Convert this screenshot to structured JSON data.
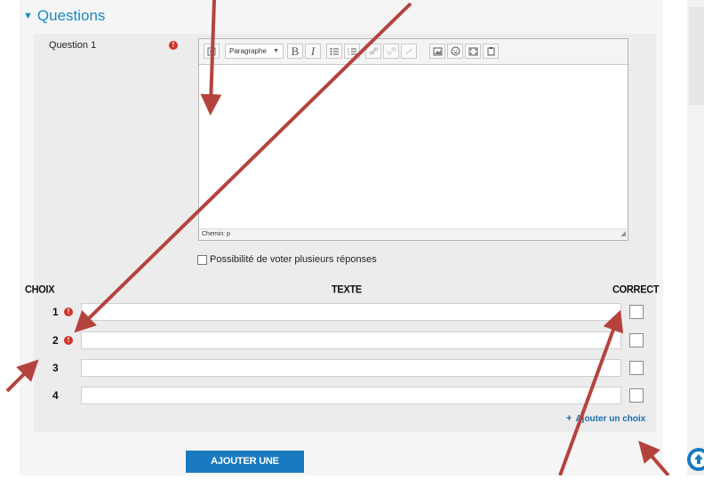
{
  "section": {
    "title": "Questions"
  },
  "question": {
    "label": "Question 1",
    "required_mark": "!"
  },
  "editor": {
    "format_select": "Paragraphe",
    "status_path": "Chemin: p",
    "toolbar": {
      "bold": "B",
      "italic": "I"
    }
  },
  "multi_vote": {
    "label": "Possibilité de voter plusieurs réponses"
  },
  "table": {
    "headers": {
      "choix": "CHOIX",
      "texte": "TEXTE",
      "correct": "CORRECT"
    },
    "rows": [
      {
        "num": "1",
        "required": true
      },
      {
        "num": "2",
        "required": true
      },
      {
        "num": "3",
        "required": false
      },
      {
        "num": "4",
        "required": false
      }
    ]
  },
  "add_choice": {
    "label": "Ajouter un choix"
  },
  "add_question": {
    "label": "AJOUTER UNE QUESTION"
  },
  "colors": {
    "accent": "#1a88c8",
    "button": "#1a7ac0",
    "required": "#d0342c",
    "annotation_arrow": "#b5433d"
  }
}
